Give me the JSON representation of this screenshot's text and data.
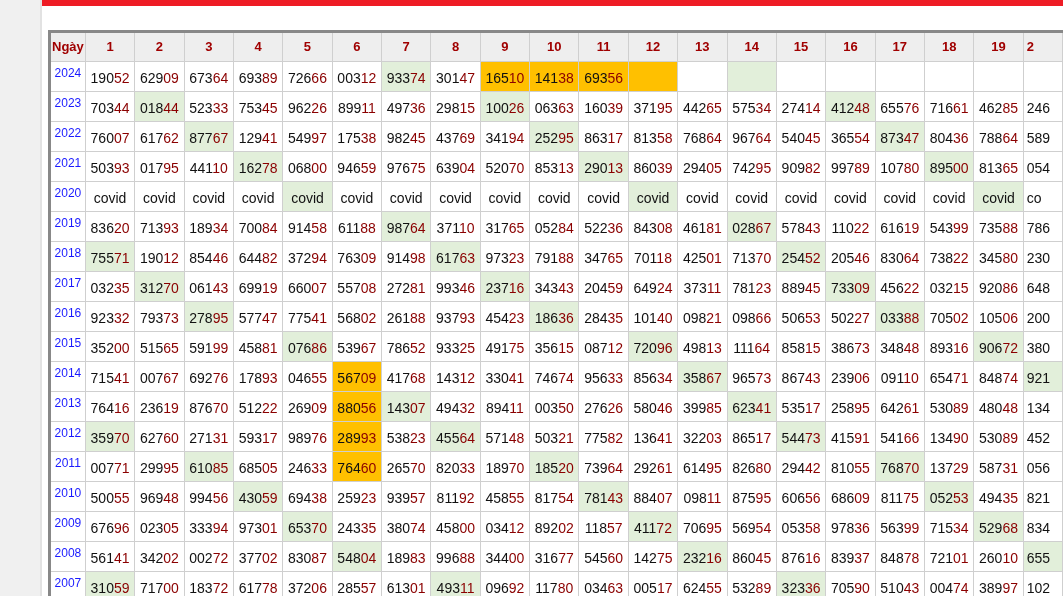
{
  "table": {
    "year_header": "Ngày",
    "columns": [
      "1",
      "2",
      "3",
      "4",
      "5",
      "6",
      "7",
      "8",
      "9",
      "10",
      "11",
      "12",
      "13",
      "14",
      "15",
      "16",
      "17",
      "18",
      "19",
      "2"
    ],
    "rows": [
      {
        "year": "2024",
        "cells": [
          {
            "text": "19052",
            "color": "#ffffff"
          },
          {
            "text": "62909",
            "color": "#ffffff"
          },
          {
            "text": "67364",
            "color": "#ffffff"
          },
          {
            "text": "69389",
            "color": "#ffffff"
          },
          {
            "text": "72666",
            "color": "#ffffff"
          },
          {
            "text": "00312",
            "color": "#ffffff"
          },
          {
            "text": "93374",
            "color": "#e2efda"
          },
          {
            "text": "30147",
            "color": "#ffffff"
          },
          {
            "text": "16510",
            "color": "#ffc000"
          },
          {
            "text": "14138",
            "color": "#ffc000"
          },
          {
            "text": "69356",
            "color": "#ffc000"
          },
          {
            "color": "#ffc000"
          },
          {
            "color": "#ffffff"
          },
          {
            "color": "#e2efda"
          },
          {
            "color": "#ffffff"
          },
          {
            "color": "#ffffff"
          },
          {
            "color": "#ffffff"
          },
          {
            "color": "#ffffff"
          },
          {
            "color": "#ffffff"
          },
          {
            "color": "#ffffff"
          }
        ]
      },
      {
        "year": "2023",
        "cells": [
          {
            "text": "70344",
            "color": "#ffffff"
          },
          {
            "text": "01844",
            "color": "#e2efda"
          },
          {
            "text": "52333",
            "color": "#ffffff"
          },
          {
            "text": "75345",
            "color": "#ffffff"
          },
          {
            "text": "96226",
            "color": "#ffffff"
          },
          {
            "text": "89911",
            "color": "#ffffff"
          },
          {
            "text": "49736",
            "color": "#ffffff"
          },
          {
            "text": "29815",
            "color": "#ffffff"
          },
          {
            "text": "10026",
            "color": "#e2efda"
          },
          {
            "text": "06363",
            "color": "#ffffff"
          },
          {
            "text": "16039",
            "color": "#ffffff"
          },
          {
            "text": "37195",
            "color": "#ffffff"
          },
          {
            "text": "44265",
            "color": "#ffffff"
          },
          {
            "text": "57534",
            "color": "#ffffff"
          },
          {
            "text": "27414",
            "color": "#ffffff"
          },
          {
            "text": "41248",
            "color": "#e2efda"
          },
          {
            "text": "65576",
            "color": "#ffffff"
          },
          {
            "text": "71661",
            "color": "#ffffff"
          },
          {
            "text": "46285",
            "color": "#ffffff"
          },
          {
            "text": "246",
            "color": "#ffffff"
          }
        ]
      },
      {
        "year": "2022",
        "cells": [
          {
            "text": "76007",
            "color": "#ffffff"
          },
          {
            "text": "61762",
            "color": "#ffffff"
          },
          {
            "text": "87767",
            "color": "#e2efda"
          },
          {
            "text": "12941",
            "color": "#ffffff"
          },
          {
            "text": "54997",
            "color": "#ffffff"
          },
          {
            "text": "17538",
            "color": "#ffffff"
          },
          {
            "text": "98245",
            "color": "#ffffff"
          },
          {
            "text": "43769",
            "color": "#ffffff"
          },
          {
            "text": "34194",
            "color": "#ffffff"
          },
          {
            "text": "25295",
            "color": "#e2efda"
          },
          {
            "text": "86317",
            "color": "#ffffff"
          },
          {
            "text": "81358",
            "color": "#ffffff"
          },
          {
            "text": "76864",
            "color": "#ffffff"
          },
          {
            "text": "96764",
            "color": "#ffffff"
          },
          {
            "text": "54045",
            "color": "#ffffff"
          },
          {
            "text": "36554",
            "color": "#ffffff"
          },
          {
            "text": "87347",
            "color": "#e2efda"
          },
          {
            "text": "80436",
            "color": "#ffffff"
          },
          {
            "text": "78864",
            "color": "#ffffff"
          },
          {
            "text": "589",
            "color": "#ffffff"
          }
        ]
      },
      {
        "year": "2021",
        "cells": [
          {
            "text": "50393",
            "color": "#ffffff"
          },
          {
            "text": "01795",
            "color": "#ffffff"
          },
          {
            "text": "44110",
            "color": "#ffffff"
          },
          {
            "text": "16278",
            "color": "#e2efda"
          },
          {
            "text": "06800",
            "color": "#ffffff"
          },
          {
            "text": "94659",
            "color": "#ffffff"
          },
          {
            "text": "97675",
            "color": "#ffffff"
          },
          {
            "text": "63904",
            "color": "#ffffff"
          },
          {
            "text": "52070",
            "color": "#ffffff"
          },
          {
            "text": "85313",
            "color": "#ffffff"
          },
          {
            "text": "29013",
            "color": "#e2efda"
          },
          {
            "text": "86039",
            "color": "#ffffff"
          },
          {
            "text": "29405",
            "color": "#ffffff"
          },
          {
            "text": "74295",
            "color": "#ffffff"
          },
          {
            "text": "90982",
            "color": "#ffffff"
          },
          {
            "text": "99789",
            "color": "#ffffff"
          },
          {
            "text": "10780",
            "color": "#ffffff"
          },
          {
            "text": "89500",
            "color": "#e2efda"
          },
          {
            "text": "81365",
            "color": "#ffffff"
          },
          {
            "text": "054",
            "color": "#ffffff"
          }
        ]
      },
      {
        "year": "2020",
        "cells": [
          {
            "text": "covid",
            "color": "#ffffff"
          },
          {
            "text": "covid",
            "color": "#ffffff"
          },
          {
            "text": "covid",
            "color": "#ffffff"
          },
          {
            "text": "covid",
            "color": "#ffffff"
          },
          {
            "text": "covid",
            "color": "#e2efda"
          },
          {
            "text": "covid",
            "color": "#ffffff"
          },
          {
            "text": "covid",
            "color": "#ffffff"
          },
          {
            "text": "covid",
            "color": "#ffffff"
          },
          {
            "text": "covid",
            "color": "#ffffff"
          },
          {
            "text": "covid",
            "color": "#ffffff"
          },
          {
            "text": "covid",
            "color": "#ffffff"
          },
          {
            "text": "covid",
            "color": "#e2efda"
          },
          {
            "text": "covid",
            "color": "#ffffff"
          },
          {
            "text": "covid",
            "color": "#ffffff"
          },
          {
            "text": "covid",
            "color": "#ffffff"
          },
          {
            "text": "covid",
            "color": "#ffffff"
          },
          {
            "text": "covid",
            "color": "#ffffff"
          },
          {
            "text": "covid",
            "color": "#ffffff"
          },
          {
            "text": "covid",
            "color": "#e2efda"
          },
          {
            "text": "co",
            "color": "#ffffff"
          }
        ]
      },
      {
        "year": "2019",
        "cells": [
          {
            "text": "83620",
            "color": "#ffffff"
          },
          {
            "text": "71393",
            "color": "#ffffff"
          },
          {
            "text": "18934",
            "color": "#ffffff"
          },
          {
            "text": "70084",
            "color": "#ffffff"
          },
          {
            "text": "91458",
            "color": "#ffffff"
          },
          {
            "text": "61188",
            "color": "#ffffff"
          },
          {
            "text": "98764",
            "color": "#e2efda"
          },
          {
            "text": "37110",
            "color": "#ffffff"
          },
          {
            "text": "31765",
            "color": "#ffffff"
          },
          {
            "text": "05284",
            "color": "#ffffff"
          },
          {
            "text": "52236",
            "color": "#ffffff"
          },
          {
            "text": "84308",
            "color": "#ffffff"
          },
          {
            "text": "46181",
            "color": "#ffffff"
          },
          {
            "text": "02867",
            "color": "#e2efda"
          },
          {
            "text": "57843",
            "color": "#ffffff"
          },
          {
            "text": "11022",
            "color": "#ffffff"
          },
          {
            "text": "61619",
            "color": "#ffffff"
          },
          {
            "text": "54399",
            "color": "#ffffff"
          },
          {
            "text": "73588",
            "color": "#ffffff"
          },
          {
            "text": "786",
            "color": "#ffffff"
          }
        ]
      },
      {
        "year": "2018",
        "cells": [
          {
            "text": "75571",
            "color": "#e2efda"
          },
          {
            "text": "19012",
            "color": "#ffffff"
          },
          {
            "text": "85446",
            "color": "#ffffff"
          },
          {
            "text": "64482",
            "color": "#ffffff"
          },
          {
            "text": "37294",
            "color": "#ffffff"
          },
          {
            "text": "76309",
            "color": "#ffffff"
          },
          {
            "text": "91498",
            "color": "#ffffff"
          },
          {
            "text": "61763",
            "color": "#e2efda"
          },
          {
            "text": "97323",
            "color": "#ffffff"
          },
          {
            "text": "79188",
            "color": "#ffffff"
          },
          {
            "text": "34765",
            "color": "#ffffff"
          },
          {
            "text": "70118",
            "color": "#ffffff"
          },
          {
            "text": "42501",
            "color": "#ffffff"
          },
          {
            "text": "71370",
            "color": "#ffffff"
          },
          {
            "text": "25452",
            "color": "#e2efda"
          },
          {
            "text": "20546",
            "color": "#ffffff"
          },
          {
            "text": "83064",
            "color": "#ffffff"
          },
          {
            "text": "73822",
            "color": "#ffffff"
          },
          {
            "text": "34580",
            "color": "#ffffff"
          },
          {
            "text": "230",
            "color": "#ffffff"
          }
        ]
      },
      {
        "year": "2017",
        "cells": [
          {
            "text": "03235",
            "color": "#ffffff"
          },
          {
            "text": "31270",
            "color": "#e2efda"
          },
          {
            "text": "06143",
            "color": "#ffffff"
          },
          {
            "text": "69919",
            "color": "#ffffff"
          },
          {
            "text": "66007",
            "color": "#ffffff"
          },
          {
            "text": "55708",
            "color": "#ffffff"
          },
          {
            "text": "27281",
            "color": "#ffffff"
          },
          {
            "text": "99346",
            "color": "#ffffff"
          },
          {
            "text": "23716",
            "color": "#e2efda"
          },
          {
            "text": "34343",
            "color": "#ffffff"
          },
          {
            "text": "20459",
            "color": "#ffffff"
          },
          {
            "text": "64924",
            "color": "#ffffff"
          },
          {
            "text": "37311",
            "color": "#ffffff"
          },
          {
            "text": "78123",
            "color": "#ffffff"
          },
          {
            "text": "88945",
            "color": "#ffffff"
          },
          {
            "text": "73309",
            "color": "#e2efda"
          },
          {
            "text": "45622",
            "color": "#ffffff"
          },
          {
            "text": "03215",
            "color": "#ffffff"
          },
          {
            "text": "92086",
            "color": "#ffffff"
          },
          {
            "text": "648",
            "color": "#ffffff"
          }
        ]
      },
      {
        "year": "2016",
        "cells": [
          {
            "text": "92332",
            "color": "#ffffff"
          },
          {
            "text": "79373",
            "color": "#ffffff"
          },
          {
            "text": "27895",
            "color": "#e2efda"
          },
          {
            "text": "57747",
            "color": "#ffffff"
          },
          {
            "text": "77541",
            "color": "#ffffff"
          },
          {
            "text": "56802",
            "color": "#ffffff"
          },
          {
            "text": "26188",
            "color": "#ffffff"
          },
          {
            "text": "93793",
            "color": "#ffffff"
          },
          {
            "text": "45423",
            "color": "#ffffff"
          },
          {
            "text": "18636",
            "color": "#e2efda"
          },
          {
            "text": "28435",
            "color": "#ffffff"
          },
          {
            "text": "10140",
            "color": "#ffffff"
          },
          {
            "text": "09821",
            "color": "#ffffff"
          },
          {
            "text": "09866",
            "color": "#ffffff"
          },
          {
            "text": "50653",
            "color": "#ffffff"
          },
          {
            "text": "50227",
            "color": "#ffffff"
          },
          {
            "text": "03388",
            "color": "#e2efda"
          },
          {
            "text": "70502",
            "color": "#ffffff"
          },
          {
            "text": "10506",
            "color": "#ffffff"
          },
          {
            "text": "200",
            "color": "#ffffff"
          }
        ]
      },
      {
        "year": "2015",
        "cells": [
          {
            "text": "35200",
            "color": "#ffffff"
          },
          {
            "text": "51565",
            "color": "#ffffff"
          },
          {
            "text": "59199",
            "color": "#ffffff"
          },
          {
            "text": "45881",
            "color": "#ffffff"
          },
          {
            "text": "07686",
            "color": "#e2efda"
          },
          {
            "text": "53967",
            "color": "#ffffff"
          },
          {
            "text": "78652",
            "color": "#ffffff"
          },
          {
            "text": "93325",
            "color": "#ffffff"
          },
          {
            "text": "49175",
            "color": "#ffffff"
          },
          {
            "text": "35615",
            "color": "#ffffff"
          },
          {
            "text": "08712",
            "color": "#ffffff"
          },
          {
            "text": "72096",
            "color": "#e2efda"
          },
          {
            "text": "49813",
            "color": "#ffffff"
          },
          {
            "text": "11164",
            "color": "#ffffff"
          },
          {
            "text": "85815",
            "color": "#ffffff"
          },
          {
            "text": "38673",
            "color": "#ffffff"
          },
          {
            "text": "34848",
            "color": "#ffffff"
          },
          {
            "text": "89316",
            "color": "#ffffff"
          },
          {
            "text": "90672",
            "color": "#e2efda"
          },
          {
            "text": "380",
            "color": "#ffffff"
          }
        ]
      },
      {
        "year": "2014",
        "cells": [
          {
            "text": "71541",
            "color": "#ffffff"
          },
          {
            "text": "00767",
            "color": "#ffffff"
          },
          {
            "text": "69276",
            "color": "#ffffff"
          },
          {
            "text": "17893",
            "color": "#ffffff"
          },
          {
            "text": "04655",
            "color": "#ffffff"
          },
          {
            "text": "56709",
            "color": "#ffc000"
          },
          {
            "text": "41768",
            "color": "#ffffff"
          },
          {
            "text": "14312",
            "color": "#ffffff"
          },
          {
            "text": "33041",
            "color": "#ffffff"
          },
          {
            "text": "74674",
            "color": "#ffffff"
          },
          {
            "text": "95633",
            "color": "#ffffff"
          },
          {
            "text": "85634",
            "color": "#ffffff"
          },
          {
            "text": "35867",
            "color": "#e2efda"
          },
          {
            "text": "96573",
            "color": "#ffffff"
          },
          {
            "text": "86743",
            "color": "#ffffff"
          },
          {
            "text": "23906",
            "color": "#ffffff"
          },
          {
            "text": "09110",
            "color": "#ffffff"
          },
          {
            "text": "65471",
            "color": "#ffffff"
          },
          {
            "text": "84874",
            "color": "#ffffff"
          },
          {
            "text": "921",
            "color": "#e2efda"
          }
        ]
      },
      {
        "year": "2013",
        "cells": [
          {
            "text": "76416",
            "color": "#ffffff"
          },
          {
            "text": "23619",
            "color": "#ffffff"
          },
          {
            "text": "87670",
            "color": "#ffffff"
          },
          {
            "text": "51222",
            "color": "#ffffff"
          },
          {
            "text": "26909",
            "color": "#ffffff"
          },
          {
            "text": "88056",
            "color": "#ffc000"
          },
          {
            "text": "14307",
            "color": "#e2efda"
          },
          {
            "text": "49432",
            "color": "#ffffff"
          },
          {
            "text": "89411",
            "color": "#ffffff"
          },
          {
            "text": "00350",
            "color": "#ffffff"
          },
          {
            "text": "27626",
            "color": "#ffffff"
          },
          {
            "text": "58046",
            "color": "#ffffff"
          },
          {
            "text": "39985",
            "color": "#ffffff"
          },
          {
            "text": "62341",
            "color": "#e2efda"
          },
          {
            "text": "53517",
            "color": "#ffffff"
          },
          {
            "text": "25895",
            "color": "#ffffff"
          },
          {
            "text": "64261",
            "color": "#ffffff"
          },
          {
            "text": "53089",
            "color": "#ffffff"
          },
          {
            "text": "48048",
            "color": "#ffffff"
          },
          {
            "text": "134",
            "color": "#ffffff"
          }
        ]
      },
      {
        "year": "2012",
        "cells": [
          {
            "text": "35970",
            "color": "#e2efda"
          },
          {
            "text": "62760",
            "color": "#ffffff"
          },
          {
            "text": "27131",
            "color": "#ffffff"
          },
          {
            "text": "59317",
            "color": "#ffffff"
          },
          {
            "text": "98976",
            "color": "#ffffff"
          },
          {
            "text": "28993",
            "color": "#ffc000"
          },
          {
            "text": "53823",
            "color": "#ffffff"
          },
          {
            "text": "45564",
            "color": "#e2efda"
          },
          {
            "text": "57148",
            "color": "#ffffff"
          },
          {
            "text": "50321",
            "color": "#ffffff"
          },
          {
            "text": "77582",
            "color": "#ffffff"
          },
          {
            "text": "13641",
            "color": "#ffffff"
          },
          {
            "text": "32203",
            "color": "#ffffff"
          },
          {
            "text": "86517",
            "color": "#ffffff"
          },
          {
            "text": "54473",
            "color": "#e2efda"
          },
          {
            "text": "41591",
            "color": "#ffffff"
          },
          {
            "text": "54166",
            "color": "#ffffff"
          },
          {
            "text": "13490",
            "color": "#ffffff"
          },
          {
            "text": "53089",
            "color": "#ffffff"
          },
          {
            "text": "452",
            "color": "#ffffff"
          }
        ]
      },
      {
        "year": "2011",
        "cells": [
          {
            "text": "00771",
            "color": "#ffffff"
          },
          {
            "text": "29995",
            "color": "#ffffff"
          },
          {
            "text": "61085",
            "color": "#e2efda"
          },
          {
            "text": "68505",
            "color": "#ffffff"
          },
          {
            "text": "24633",
            "color": "#ffffff"
          },
          {
            "text": "76460",
            "color": "#ffc000"
          },
          {
            "text": "26570",
            "color": "#ffffff"
          },
          {
            "text": "82033",
            "color": "#ffffff"
          },
          {
            "text": "18970",
            "color": "#ffffff"
          },
          {
            "text": "18520",
            "color": "#e2efda"
          },
          {
            "text": "73964",
            "color": "#ffffff"
          },
          {
            "text": "29261",
            "color": "#ffffff"
          },
          {
            "text": "61495",
            "color": "#ffffff"
          },
          {
            "text": "82680",
            "color": "#ffffff"
          },
          {
            "text": "29442",
            "color": "#ffffff"
          },
          {
            "text": "81055",
            "color": "#ffffff"
          },
          {
            "text": "76870",
            "color": "#e2efda"
          },
          {
            "text": "13729",
            "color": "#ffffff"
          },
          {
            "text": "58731",
            "color": "#ffffff"
          },
          {
            "text": "056",
            "color": "#ffffff"
          }
        ]
      },
      {
        "year": "2010",
        "cells": [
          {
            "text": "50055",
            "color": "#ffffff"
          },
          {
            "text": "96948",
            "color": "#ffffff"
          },
          {
            "text": "99456",
            "color": "#ffffff"
          },
          {
            "text": "43059",
            "color": "#e2efda"
          },
          {
            "text": "69438",
            "color": "#ffffff"
          },
          {
            "text": "25923",
            "color": "#ffffff"
          },
          {
            "text": "93957",
            "color": "#ffffff"
          },
          {
            "text": "81192",
            "color": "#ffffff"
          },
          {
            "text": "45855",
            "color": "#ffffff"
          },
          {
            "text": "81754",
            "color": "#ffffff"
          },
          {
            "text": "78143",
            "color": "#e2efda"
          },
          {
            "text": "88407",
            "color": "#ffffff"
          },
          {
            "text": "09811",
            "color": "#ffffff"
          },
          {
            "text": "87595",
            "color": "#ffffff"
          },
          {
            "text": "60656",
            "color": "#ffffff"
          },
          {
            "text": "68609",
            "color": "#ffffff"
          },
          {
            "text": "81175",
            "color": "#ffffff"
          },
          {
            "text": "05253",
            "color": "#e2efda"
          },
          {
            "text": "49435",
            "color": "#ffffff"
          },
          {
            "text": "821",
            "color": "#ffffff"
          }
        ]
      },
      {
        "year": "2009",
        "cells": [
          {
            "text": "67696",
            "color": "#ffffff"
          },
          {
            "text": "02305",
            "color": "#ffffff"
          },
          {
            "text": "33394",
            "color": "#ffffff"
          },
          {
            "text": "97301",
            "color": "#ffffff"
          },
          {
            "text": "65370",
            "color": "#e2efda"
          },
          {
            "text": "24335",
            "color": "#ffffff"
          },
          {
            "text": "38074",
            "color": "#ffffff"
          },
          {
            "text": "45800",
            "color": "#ffffff"
          },
          {
            "text": "03412",
            "color": "#ffffff"
          },
          {
            "text": "89202",
            "color": "#ffffff"
          },
          {
            "text": "11857",
            "color": "#ffffff"
          },
          {
            "text": "41172",
            "color": "#e2efda"
          },
          {
            "text": "70695",
            "color": "#ffffff"
          },
          {
            "text": "56954",
            "color": "#ffffff"
          },
          {
            "text": "05358",
            "color": "#ffffff"
          },
          {
            "text": "97836",
            "color": "#ffffff"
          },
          {
            "text": "56399",
            "color": "#ffffff"
          },
          {
            "text": "71534",
            "color": "#ffffff"
          },
          {
            "text": "52968",
            "color": "#e2efda"
          },
          {
            "text": "834",
            "color": "#ffffff"
          }
        ]
      },
      {
        "year": "2008",
        "cells": [
          {
            "text": "56141",
            "color": "#ffffff"
          },
          {
            "text": "34202",
            "color": "#ffffff"
          },
          {
            "text": "00272",
            "color": "#ffffff"
          },
          {
            "text": "37702",
            "color": "#ffffff"
          },
          {
            "text": "83087",
            "color": "#ffffff"
          },
          {
            "text": "54804",
            "color": "#e2efda"
          },
          {
            "text": "18983",
            "color": "#ffffff"
          },
          {
            "text": "99688",
            "color": "#ffffff"
          },
          {
            "text": "34400",
            "color": "#ffffff"
          },
          {
            "text": "31677",
            "color": "#ffffff"
          },
          {
            "text": "54560",
            "color": "#ffffff"
          },
          {
            "text": "14275",
            "color": "#ffffff"
          },
          {
            "text": "23216",
            "color": "#e2efda"
          },
          {
            "text": "86045",
            "color": "#ffffff"
          },
          {
            "text": "87616",
            "color": "#ffffff"
          },
          {
            "text": "83937",
            "color": "#ffffff"
          },
          {
            "text": "84878",
            "color": "#ffffff"
          },
          {
            "text": "72101",
            "color": "#ffffff"
          },
          {
            "text": "26010",
            "color": "#ffffff"
          },
          {
            "text": "655",
            "color": "#e2efda"
          }
        ]
      },
      {
        "year": "2007",
        "cells": [
          {
            "text": "31059",
            "color": "#e2efda"
          },
          {
            "text": "71700",
            "color": "#ffffff"
          },
          {
            "text": "18372",
            "color": "#ffffff"
          },
          {
            "text": "61778",
            "color": "#ffffff"
          },
          {
            "text": "37206",
            "color": "#ffffff"
          },
          {
            "text": "28557",
            "color": "#ffffff"
          },
          {
            "text": "61301",
            "color": "#ffffff"
          },
          {
            "text": "49311",
            "color": "#e2efda"
          },
          {
            "text": "09692",
            "color": "#ffffff"
          },
          {
            "text": "11780",
            "color": "#ffffff"
          },
          {
            "text": "03463",
            "color": "#ffffff"
          },
          {
            "text": "00517",
            "color": "#ffffff"
          },
          {
            "text": "62455",
            "color": "#ffffff"
          },
          {
            "text": "53289",
            "color": "#ffffff"
          },
          {
            "text": "32336",
            "color": "#e2efda"
          },
          {
            "text": "70590",
            "color": "#ffffff"
          },
          {
            "text": "51043",
            "color": "#ffffff"
          },
          {
            "text": "00474",
            "color": "#ffffff"
          },
          {
            "text": "38997",
            "color": "#ffffff"
          },
          {
            "text": "102",
            "color": "#ffffff"
          }
        ]
      }
    ]
  }
}
